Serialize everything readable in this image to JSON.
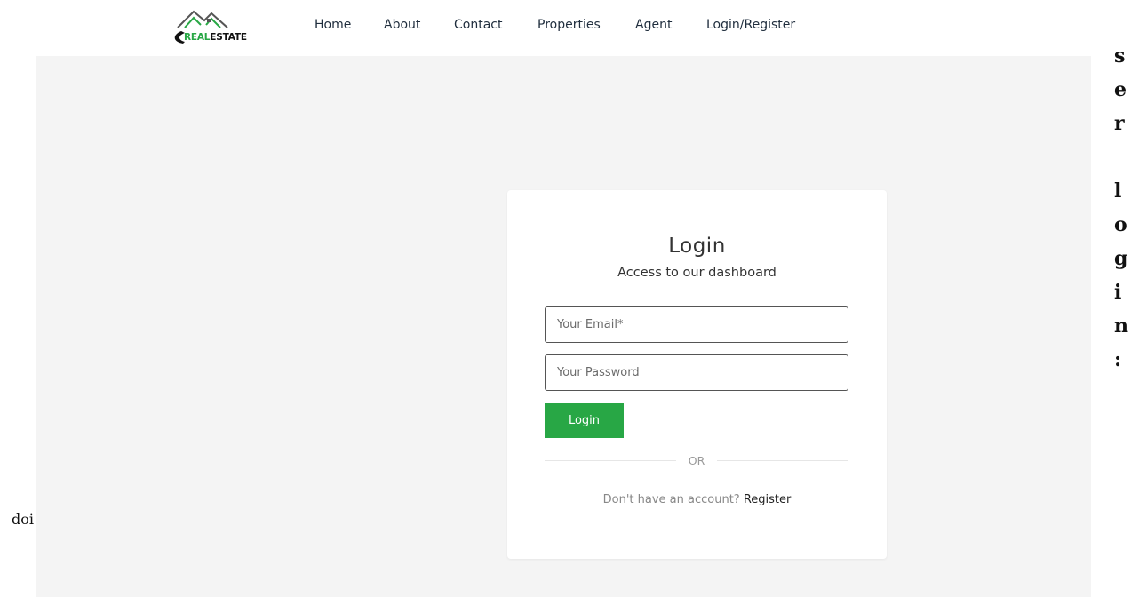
{
  "brand": {
    "logo_green": "REAL",
    "logo_dark": "ESTATE",
    "accent_color": "#28a745"
  },
  "nav": {
    "items": [
      "Home",
      "About",
      "Contact",
      "Properties",
      "Agent",
      "Login/Register"
    ]
  },
  "login": {
    "title": "Login",
    "subtitle": "Access to our dashboard",
    "email_placeholder": "Your Email*",
    "password_placeholder": "Your Password",
    "button_label": "Login",
    "divider_text": "OR",
    "signup_prompt": "Don't have an account?",
    "signup_link": "Register"
  },
  "stray_text": {
    "right_vertical": [
      "s",
      "e",
      "r",
      "",
      "l",
      "o",
      "g",
      "i",
      "n",
      ":"
    ],
    "left_fragment": "doi"
  }
}
